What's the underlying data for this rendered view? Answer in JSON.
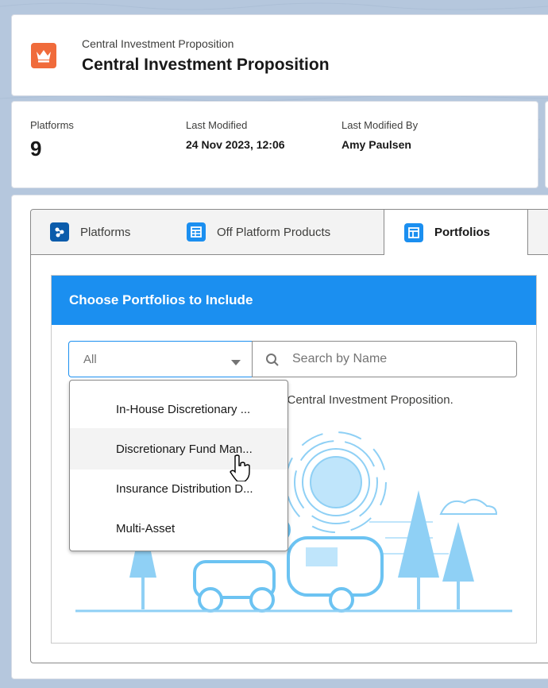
{
  "header": {
    "subtitle": "Central Investment Proposition",
    "title": "Central Investment Proposition"
  },
  "highlights": [
    {
      "label": "Platforms",
      "value": "9"
    },
    {
      "label": "Last Modified",
      "value": "24 Nov 2023, 12:06"
    },
    {
      "label": "Last Modified By",
      "value": "Amy Paulsen"
    }
  ],
  "tabs": [
    {
      "label": "Platforms",
      "icon": "platforms-icon",
      "color": "#066afe",
      "active": false
    },
    {
      "label": "Off Platform Products",
      "icon": "table-icon",
      "color": "#1b8ff0",
      "active": false
    },
    {
      "label": "Portfolios",
      "icon": "portfolio-icon",
      "color": "#1b8ff0",
      "active": true
    }
  ],
  "panel": {
    "title": "Choose Portfolios to Include",
    "filter_value": "All",
    "search_placeholder": "Search by Name",
    "info_text": "e Central Investment Proposition."
  },
  "dropdown": {
    "options": [
      "In-House Discretionary ...",
      "Discretionary Fund Man...",
      "Insurance Distribution D...",
      "Multi-Asset"
    ],
    "hovered_index": 1
  },
  "colors": {
    "brand_blue": "#1b8ff0",
    "header_icon": "#f06b3b",
    "background": "#b5c7dd"
  }
}
